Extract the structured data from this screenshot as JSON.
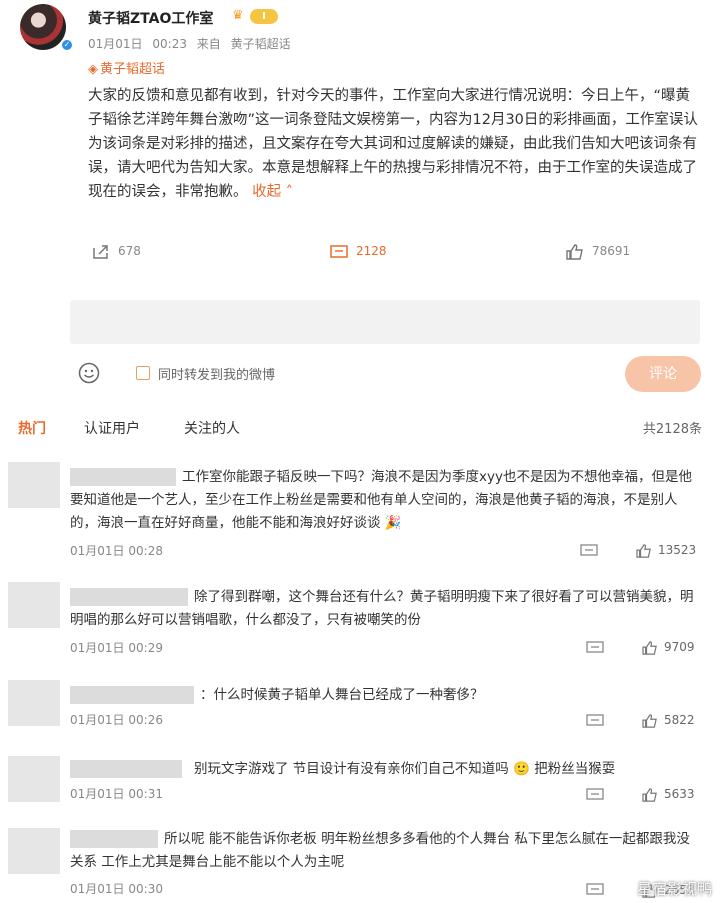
{
  "post": {
    "username": "黄子韬ZTAO工作室",
    "level": "Ⅰ",
    "date": "01月01日",
    "time": "00:23",
    "source_prefix": "来自",
    "source": "黄子韬超话",
    "supertopic": "黄子韬超话",
    "text": "大家的反馈和意见都有收到，针对今天的事件，工作室向大家进行情况说明：今日上午，“曝黄子韬徐艺洋跨年舞台激吻”这一词条登陆文娱榜第一，内容为12月30日的彩排画面，工作室误认为该词条是对彩排的描述，且文案存在夸大其词和过度解读的嫌疑，由此我们告知大吧该词条有误，请大吧代为告知大家。本意是想解释上午的热搜与彩排情况不符，由于工作室的失误造成了现在的误会，非常抱歉。",
    "collapse": "收起",
    "share_count": "678",
    "comment_count": "2128",
    "like_count": "78691"
  },
  "compose": {
    "repost_label": "同时转发到我的微博",
    "submit_label": "评论"
  },
  "tabs": {
    "hot": "热门",
    "verified": "认证用户",
    "following": "关注的人",
    "total": "共2128条"
  },
  "comments": [
    {
      "text": "工作室你能跟子韬反映一下吗？海浪不是因为季度xyy也不是因为不想他幸福，但是他要知道他是一个艺人，至少在工作上粉丝是需要和他有单人空间的，海浪是他黄子韬的海浪，不是别人的，海浪一直在好好商量，他能不能和海浪好好谈谈",
      "date": "01月01日",
      "time": "00:28",
      "likes": "13523"
    },
    {
      "text": "除了得到群嘲，这个舞台还有什么？黄子韬明明瘦下来了很好看了可以营销美貌，明明唱的那么好可以营销唱歌，什么都没了，只有被嘲笑的份",
      "date": "01月01日",
      "time": "00:29",
      "likes": "9709"
    },
    {
      "text": "：什么时候黄子韬单人舞台已经成了一种奢侈？",
      "date": "01月01日",
      "time": "00:26",
      "likes": "5822"
    },
    {
      "text": "别玩文字游戏了 节目设计有没有亲你们自己不知道吗",
      "text_after": "把粉丝当猴耍",
      "date": "01月01日",
      "time": "00:31",
      "likes": "5633"
    },
    {
      "text": "所以呢 能不能告诉你老板 明年粉丝想多多看他的个人舞台 私下里怎么腻在一起都跟我没关系 工作上尤其是舞台上能不能以个人为主呢",
      "date": "01月01日",
      "time": "00:30",
      "likes": "2653"
    }
  ],
  "watermark": "星宿影视鸭",
  "colors": {
    "accent": "#e86b2c",
    "submit_bg": "#f7c4a8",
    "verify": "#2e90e6"
  },
  "icons": [
    "crown-icon",
    "verified-icon",
    "diamond-icon",
    "share-icon",
    "comment-icon",
    "like-icon",
    "emoji-icon",
    "reply-icon",
    "party-popper-icon",
    "smile-emoji-icon"
  ]
}
